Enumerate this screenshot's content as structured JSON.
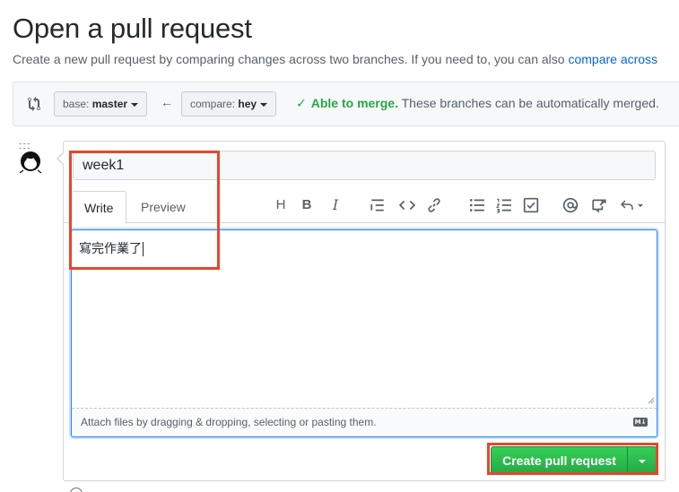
{
  "header": {
    "title": "Open a pull request",
    "subtitle_text": "Create a new pull request by comparing changes across two branches. If you need to, you can also ",
    "subtitle_link": "compare across"
  },
  "branches": {
    "base_label": "base:",
    "base_value": "master",
    "compare_label": "compare:",
    "compare_value": "hey",
    "merge_able": "Able to merge.",
    "merge_detail": "These branches can be automatically merged."
  },
  "form": {
    "title_value": "week1",
    "tabs": [
      {
        "label": "Write",
        "active": true
      },
      {
        "label": "Preview",
        "active": false
      }
    ],
    "toolbar_icons": [
      "heading-icon",
      "bold-icon",
      "italic-icon",
      "quote-icon",
      "code-icon",
      "link-icon",
      "bulleted-list-icon",
      "numbered-list-icon",
      "task-list-icon",
      "mention-icon",
      "reference-icon",
      "reply-icon"
    ],
    "body_value": "寫完作業了",
    "attach_hint": "Attach files by dragging & dropping, selecting or pasting them.",
    "markdown_badge": "M↓"
  },
  "actions": {
    "create_label": "Create pull request"
  },
  "colors": {
    "accent_green": "#28a745",
    "link_blue": "#0366d6",
    "highlight_red": "#e8452c"
  }
}
